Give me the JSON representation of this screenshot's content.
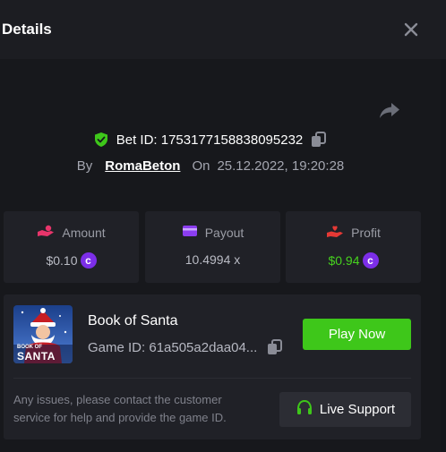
{
  "header": {
    "title": "Details"
  },
  "bet": {
    "bet_id_label": "Bet ID: 1753177158838095232",
    "by_label": "By",
    "user": "RomaBeton",
    "on_label": "On",
    "datetime": "25.12.2022, 19:20:28"
  },
  "stats": {
    "amount": {
      "label": "Amount",
      "value": "$0.10"
    },
    "payout": {
      "label": "Payout",
      "value": "10.4994 x"
    },
    "profit": {
      "label": "Profit",
      "value": "$0.94"
    }
  },
  "game": {
    "name": "Book of Santa",
    "game_id": "Game ID: 61a505a2daa04...",
    "play_label": "Play Now",
    "thumb_text_top": "BOOK OF",
    "thumb_text_bottom": "SANTA"
  },
  "support": {
    "message": "Any issues, please contact the customer service for help and provide the game ID.",
    "button_label": "Live Support"
  },
  "colors": {
    "accent_green": "#3ec71a",
    "profit_green": "#46d21e",
    "coin_purple": "#7c2ee8",
    "amount_icon": "#e8356b",
    "payout_icon": "#8b3df0",
    "profit_icon": "#e53935"
  },
  "icons": {
    "close": "close-icon",
    "share": "share-icon",
    "verified": "shield-check-icon",
    "copy": "copy-icon",
    "amount": "hand-coins-icon",
    "payout": "wallet-icon",
    "profit": "hand-heart-icon",
    "coin": "coin-icon",
    "support": "headset-icon"
  }
}
